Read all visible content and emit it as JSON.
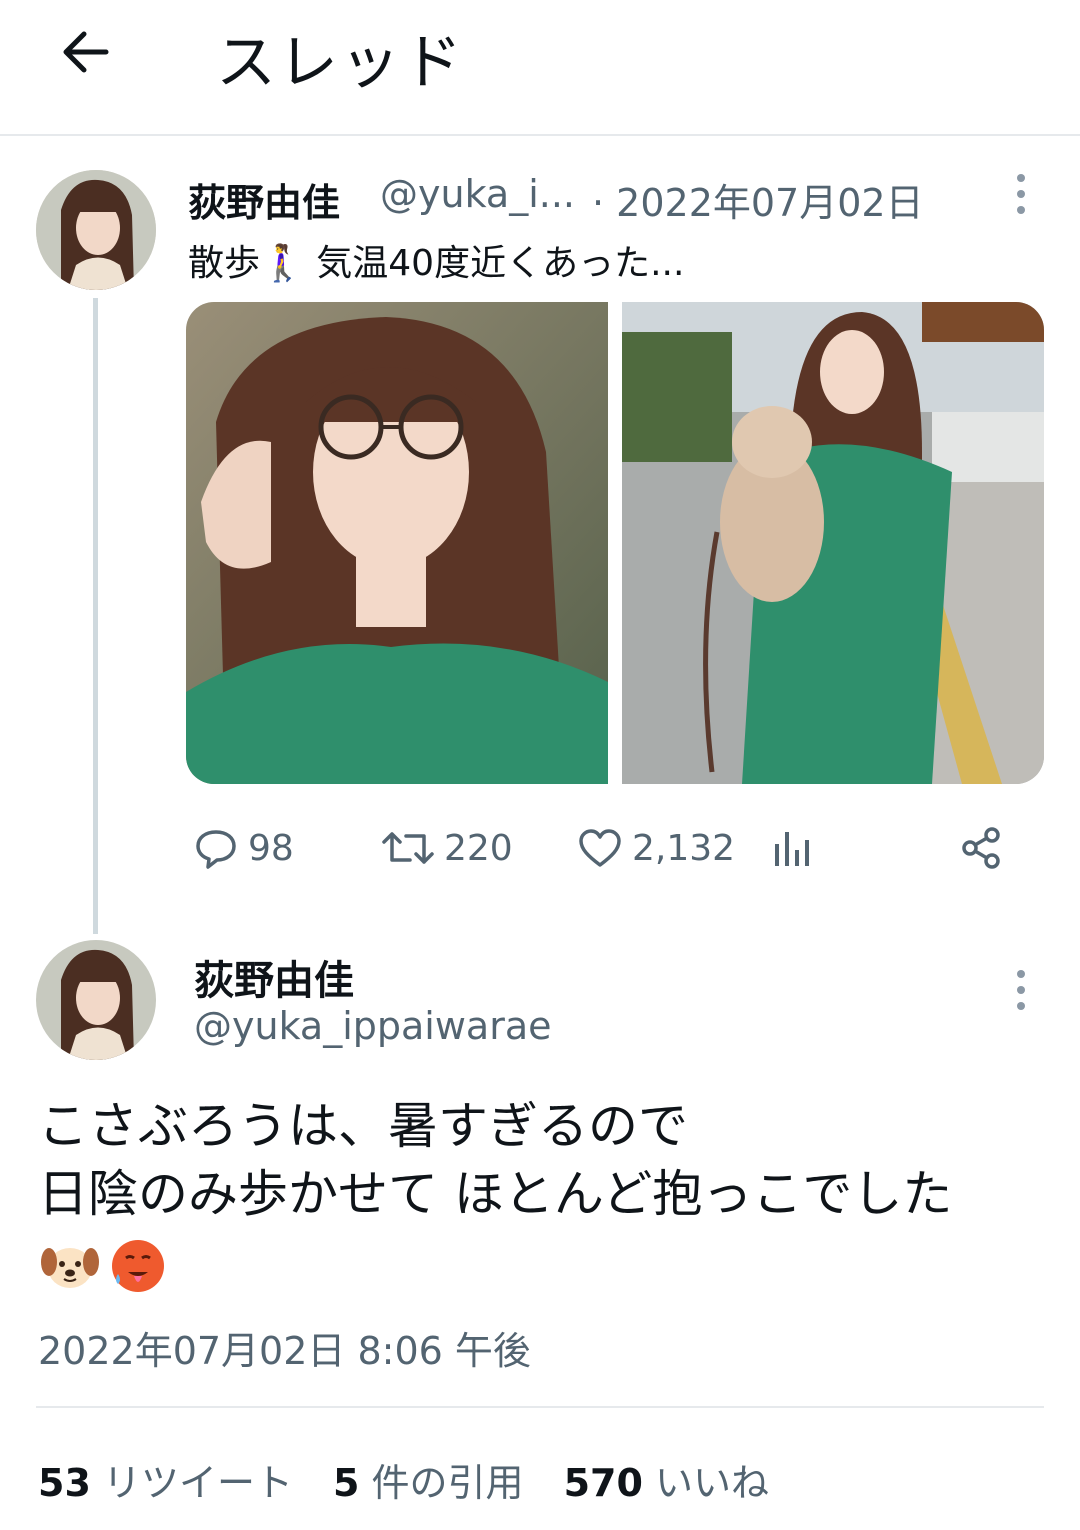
{
  "header": {
    "title": "スレッド"
  },
  "tweet1": {
    "name": "荻野由佳",
    "handle": "@yuka_i...",
    "date": "· 2022年07月02日",
    "text": "散歩🚶‍♀️ 気温40度近くあった...",
    "actions": {
      "replies": "98",
      "retweets": "220",
      "likes": "2,132"
    }
  },
  "tweet2": {
    "name": "荻野由佳",
    "handle": "@yuka_ippaiwarae",
    "text_line1": "こさぶろうは、暑すぎるので",
    "text_line2": "日陰のみ歩かせて ほとんど抱っこでした",
    "timestamp": "2022年07月02日 8:06 午後",
    "stats": [
      {
        "count": "53",
        "label": "リツイート"
      },
      {
        "count": "5",
        "label": "件の引用"
      },
      {
        "count": "570",
        "label": "いいね"
      }
    ]
  },
  "colors": {
    "text": "#0f1419",
    "secondary": "#536471",
    "divider": "#e6e9ec",
    "thread_line": "#cfd9de"
  },
  "icons": [
    "back-arrow-icon",
    "more-icon",
    "reply-icon",
    "retweet-icon",
    "like-icon",
    "analytics-icon",
    "share-icon",
    "dog-face-emoji",
    "hot-face-emoji"
  ]
}
